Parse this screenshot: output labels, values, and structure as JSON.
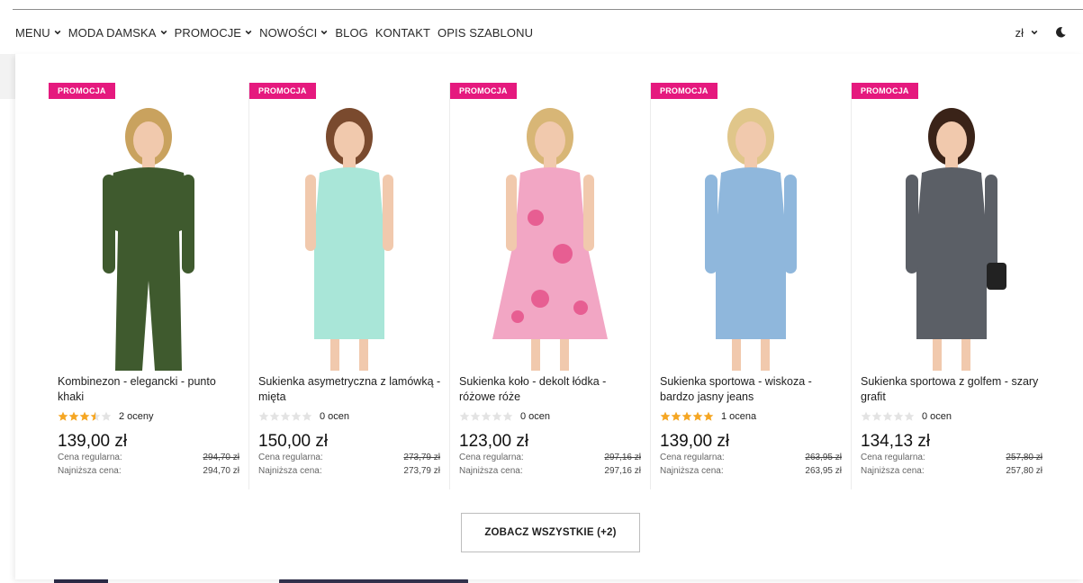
{
  "nav": {
    "items": [
      {
        "label": "MENU",
        "has_dropdown": true
      },
      {
        "label": "MODA DAMSKA",
        "has_dropdown": true
      },
      {
        "label": "PROMOCJE",
        "has_dropdown": true
      },
      {
        "label": "NOWOŚCI",
        "has_dropdown": true
      },
      {
        "label": "BLOG",
        "has_dropdown": false
      },
      {
        "label": "KONTAKT",
        "has_dropdown": false
      },
      {
        "label": "OPIS SZABLONU",
        "has_dropdown": false
      }
    ],
    "currency": "zł",
    "theme_icon": "moon-icon"
  },
  "colors": {
    "badge": "#e5197e",
    "star_filled": "#f5a623",
    "star_empty": "#e3e3e3"
  },
  "products": [
    {
      "badge": "PROMOCJA",
      "name": "Kombinezon - elegancki - punto khaki",
      "rating": 3.5,
      "reviews": "2 oceny",
      "price": "139,00 zł",
      "regular_label": "Cena regularna:",
      "regular_price": "294,70 zł",
      "lowest_label": "Najniższa cena:",
      "lowest_price": "294,70 zł",
      "garment_color": "#3f5a2e"
    },
    {
      "badge": "PROMOCJA",
      "name": "Sukienka asymetryczna z lamówką - mięta",
      "rating": 0,
      "reviews": "0 ocen",
      "price": "150,00 zł",
      "regular_label": "Cena regularna:",
      "regular_price": "273,79 zł",
      "lowest_label": "Najniższa cena:",
      "lowest_price": "273,79 zł",
      "garment_color": "#a9e6d8"
    },
    {
      "badge": "PROMOCJA",
      "name": "Sukienka koło - dekolt łódka - różowe róże",
      "rating": 0,
      "reviews": "0 ocen",
      "price": "123,00 zł",
      "regular_label": "Cena regularna:",
      "regular_price": "297,16 zł",
      "lowest_label": "Najniższa cena:",
      "lowest_price": "297,16 zł",
      "garment_color": "#f2a6c4"
    },
    {
      "badge": "PROMOCJA",
      "name": "Sukienka sportowa - wiskoza - bardzo jasny jeans",
      "rating": 5,
      "reviews": "1 ocena",
      "price": "139,00 zł",
      "regular_label": "Cena regularna:",
      "regular_price": "263,95 zł",
      "lowest_label": "Najniższa cena:",
      "lowest_price": "263,95 zł",
      "garment_color": "#8fb7dc"
    },
    {
      "badge": "PROMOCJA",
      "name": "Sukienka sportowa z golfem - szary grafit",
      "rating": 0,
      "reviews": "0 ocen",
      "price": "134,13 zł",
      "regular_label": "Cena regularna:",
      "regular_price": "257,80 zł",
      "lowest_label": "Najniższa cena:",
      "lowest_price": "257,80 zł",
      "garment_color": "#5b5f66"
    }
  ],
  "see_all_label": "ZOBACZ WSZYSTKIE (+2)"
}
